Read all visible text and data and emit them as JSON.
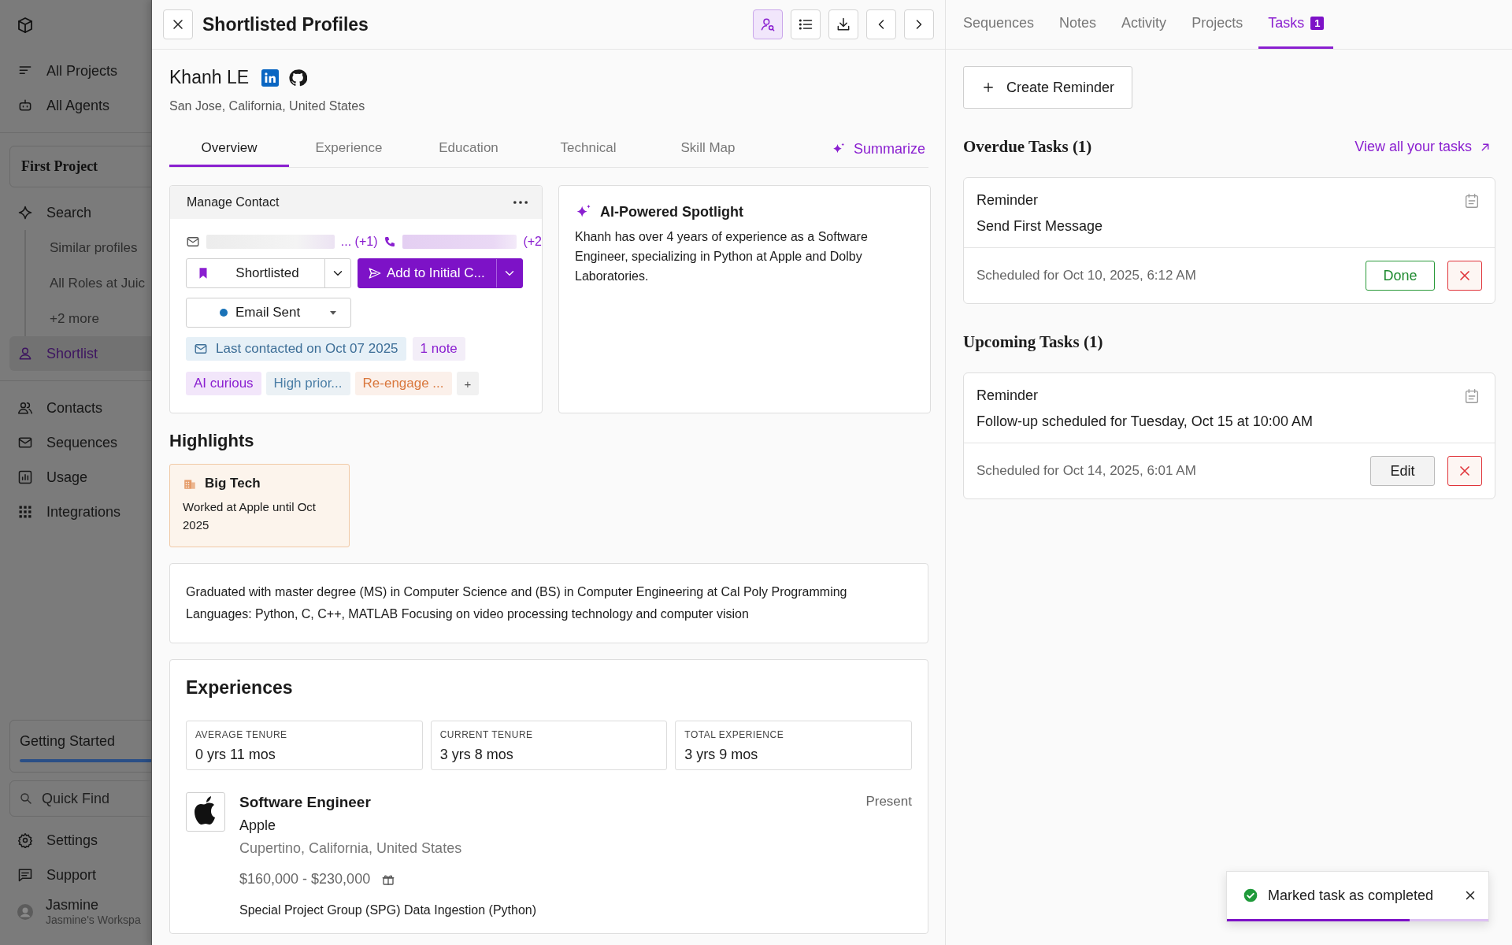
{
  "sidebar": {
    "nav": [
      {
        "label": "All Projects"
      },
      {
        "label": "All Agents"
      }
    ],
    "project": {
      "name": "First Project"
    },
    "project_items": [
      {
        "label": "Search",
        "selected": false,
        "children": [
          {
            "label": "Similar profiles"
          },
          {
            "label": "All Roles at Juic"
          },
          {
            "label": "+2 more"
          }
        ]
      },
      {
        "label": "Shortlist",
        "selected": true
      }
    ],
    "tools": [
      {
        "label": "Contacts"
      },
      {
        "label": "Sequences"
      },
      {
        "label": "Usage"
      },
      {
        "label": "Integrations"
      }
    ],
    "getting_started": {
      "label": "Getting Started",
      "level": 1
    },
    "quick_find": {
      "placeholder": "Quick Find"
    },
    "footer": [
      {
        "label": "Settings"
      },
      {
        "label": "Support"
      }
    ],
    "user": {
      "name": "Jasmine",
      "workspace": "Jasmine's Workspa"
    }
  },
  "drawer": {
    "title": "Shortlisted Profiles",
    "toolbar": [
      {
        "selected": true
      },
      {
        "selected": false
      },
      {
        "selected": false
      },
      {
        "selected": false
      },
      {
        "selected": false
      }
    ],
    "profile": {
      "name": "Khanh LE",
      "location": "San Jose, California, United States"
    },
    "tabs": [
      {
        "label": "Overview",
        "selected": true
      },
      {
        "label": "Experience",
        "selected": false
      },
      {
        "label": "Education",
        "selected": false
      },
      {
        "label": "Technical",
        "selected": false
      },
      {
        "label": "Skill Map",
        "selected": false
      }
    ],
    "summarize": "Summarize",
    "manage_contact": {
      "title": "Manage Contact",
      "email_more": "... (+1)",
      "phone_more": "(+2",
      "stage": "Shortlisted",
      "sequence_button": "Add to Initial C...",
      "status": "Email Sent",
      "last_contacted": "Last contacted on Oct 07 2025",
      "notes": "1 note",
      "tags": [
        {
          "label": "AI curious",
          "color": "#8a1fd0"
        },
        {
          "label": "High prior...",
          "color": "#4b7ea6"
        },
        {
          "label": "Re-engage ...",
          "color": "#d9773c"
        }
      ],
      "add_tag": "+"
    },
    "spotlight": {
      "title": "AI-Powered Spotlight",
      "text": "Khanh has over 4 years of experience as a Software Engineer, specializing in Python at Apple and Dolby Laboratories."
    },
    "highlights": {
      "heading": "Highlights",
      "items": [
        {
          "title": "Big Tech",
          "text": "Worked at Apple until Oct 2025"
        }
      ]
    },
    "education": "Graduated with master degree (MS) in Computer Science and (BS) in Computer Engineering at Cal Poly Programming Languages: Python, C, C++, MATLAB Focusing on video processing technology and computer vision",
    "experiences": {
      "heading": "Experiences",
      "stats": [
        {
          "label": "AVERAGE TENURE",
          "value": "0 yrs 11 mos"
        },
        {
          "label": "CURRENT TENURE",
          "value": "3 yrs 8 mos"
        },
        {
          "label": "TOTAL EXPERIENCE",
          "value": "3 yrs 9 mos"
        }
      ],
      "jobs": [
        {
          "title": "Software Engineer",
          "company": "Apple",
          "location": "Cupertino, California, United States",
          "salary": "$160,000 - $230,000",
          "period": "Present",
          "description": "Special Project Group (SPG) Data Ingestion (Python)"
        }
      ]
    }
  },
  "tasks_panel": {
    "tabs": [
      {
        "label": "Sequences",
        "selected": false
      },
      {
        "label": "Notes",
        "selected": false
      },
      {
        "label": "Activity",
        "selected": false
      },
      {
        "label": "Projects",
        "selected": false
      },
      {
        "label": "Tasks",
        "selected": true,
        "badge": "1"
      }
    ],
    "create_button": "Create Reminder",
    "sections": [
      {
        "heading": "Overdue Tasks (1)",
        "link": "View all your tasks",
        "tasks": [
          {
            "type": "Reminder",
            "text": "Send First Message",
            "scheduled": "Scheduled for Oct 10, 2025, 6:12 AM",
            "actions": [
              {
                "kind": "done",
                "label": "Done"
              },
              {
                "kind": "delete"
              }
            ]
          }
        ]
      },
      {
        "heading": "Upcoming Tasks (1)",
        "tasks": [
          {
            "type": "Reminder",
            "text": "Follow-up scheduled for Tuesday, Oct 15 at 10:00 AM",
            "scheduled": "Scheduled for Oct 14, 2025, 6:01 AM",
            "actions": [
              {
                "kind": "edit",
                "label": "Edit"
              },
              {
                "kind": "delete"
              }
            ]
          }
        ]
      }
    ]
  },
  "toast": {
    "message": "Marked task as completed",
    "level": 0.7
  }
}
